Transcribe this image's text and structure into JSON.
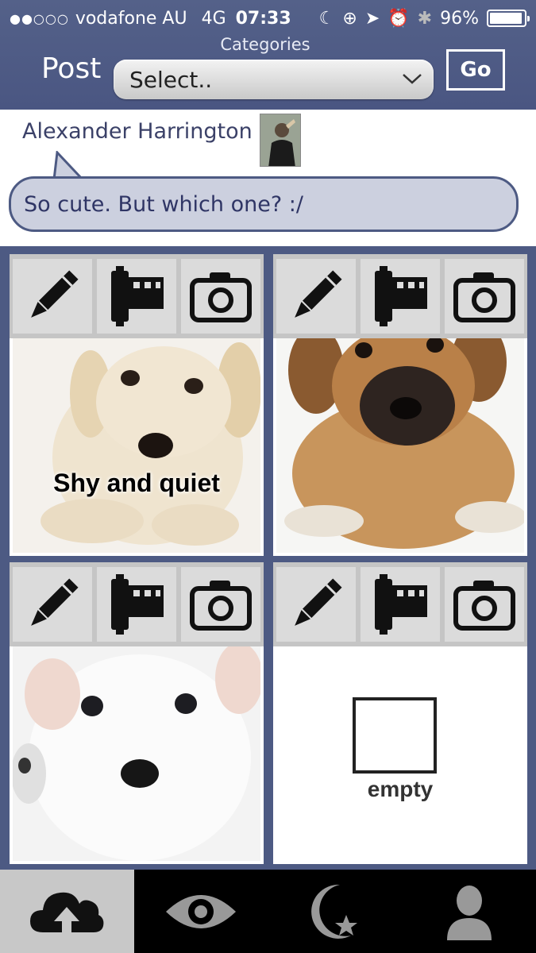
{
  "status_bar": {
    "signal": "●●○○○",
    "carrier": "vodafone AU",
    "network": "4G",
    "time": "07:33",
    "battery_percent": "96%",
    "battery_level": 0.96
  },
  "header": {
    "categories_label": "Categories",
    "post_label": "Post",
    "select_value": "Select..",
    "go_label": "Go"
  },
  "comment": {
    "author": "Alexander Harrington",
    "text": "So cute. But which one? :/"
  },
  "posts": [
    {
      "caption": "Shy and quiet",
      "photo": "cream-labrador-puppy"
    },
    {
      "caption": "",
      "photo": "brown-shepherd-puppy"
    },
    {
      "caption": "",
      "photo": "white-terrier-puppy"
    },
    {
      "caption": "",
      "photo": "empty",
      "empty_label": "empty"
    }
  ],
  "tabs": [
    {
      "name": "upload-cloud-icon",
      "active": true
    },
    {
      "name": "eye-icon",
      "active": false
    },
    {
      "name": "moon-star-icon",
      "active": false
    },
    {
      "name": "profile-icon",
      "active": false
    }
  ],
  "colors": {
    "accent": "#4d5a83",
    "bubble": "#ccd0df",
    "text_dark": "#2f3565"
  }
}
